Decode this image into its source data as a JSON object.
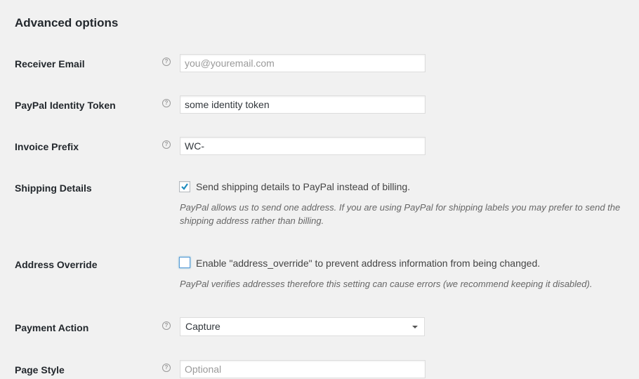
{
  "title": "Advanced options",
  "fields": {
    "receiver_email": {
      "label": "Receiver Email",
      "placeholder": "you@youremail.com"
    },
    "identity_token": {
      "label": "PayPal Identity Token",
      "value": "some identity token"
    },
    "invoice_prefix": {
      "label": "Invoice Prefix",
      "value": "WC-"
    },
    "shipping_details": {
      "label": "Shipping Details",
      "checkbox_label": "Send shipping details to PayPal instead of billing.",
      "checked": true,
      "description": "PayPal allows us to send one address. If you are using PayPal for shipping labels you may prefer to send the shipping address rather than billing."
    },
    "address_override": {
      "label": "Address Override",
      "checkbox_label": "Enable \"address_override\" to prevent address information from being changed.",
      "checked": false,
      "description": "PayPal verifies addresses therefore this setting can cause errors (we recommend keeping it disabled)."
    },
    "payment_action": {
      "label": "Payment Action",
      "value": "Capture"
    },
    "page_style": {
      "label": "Page Style",
      "placeholder": "Optional"
    }
  },
  "help_icon": "?",
  "accent": "#1e8cbe"
}
